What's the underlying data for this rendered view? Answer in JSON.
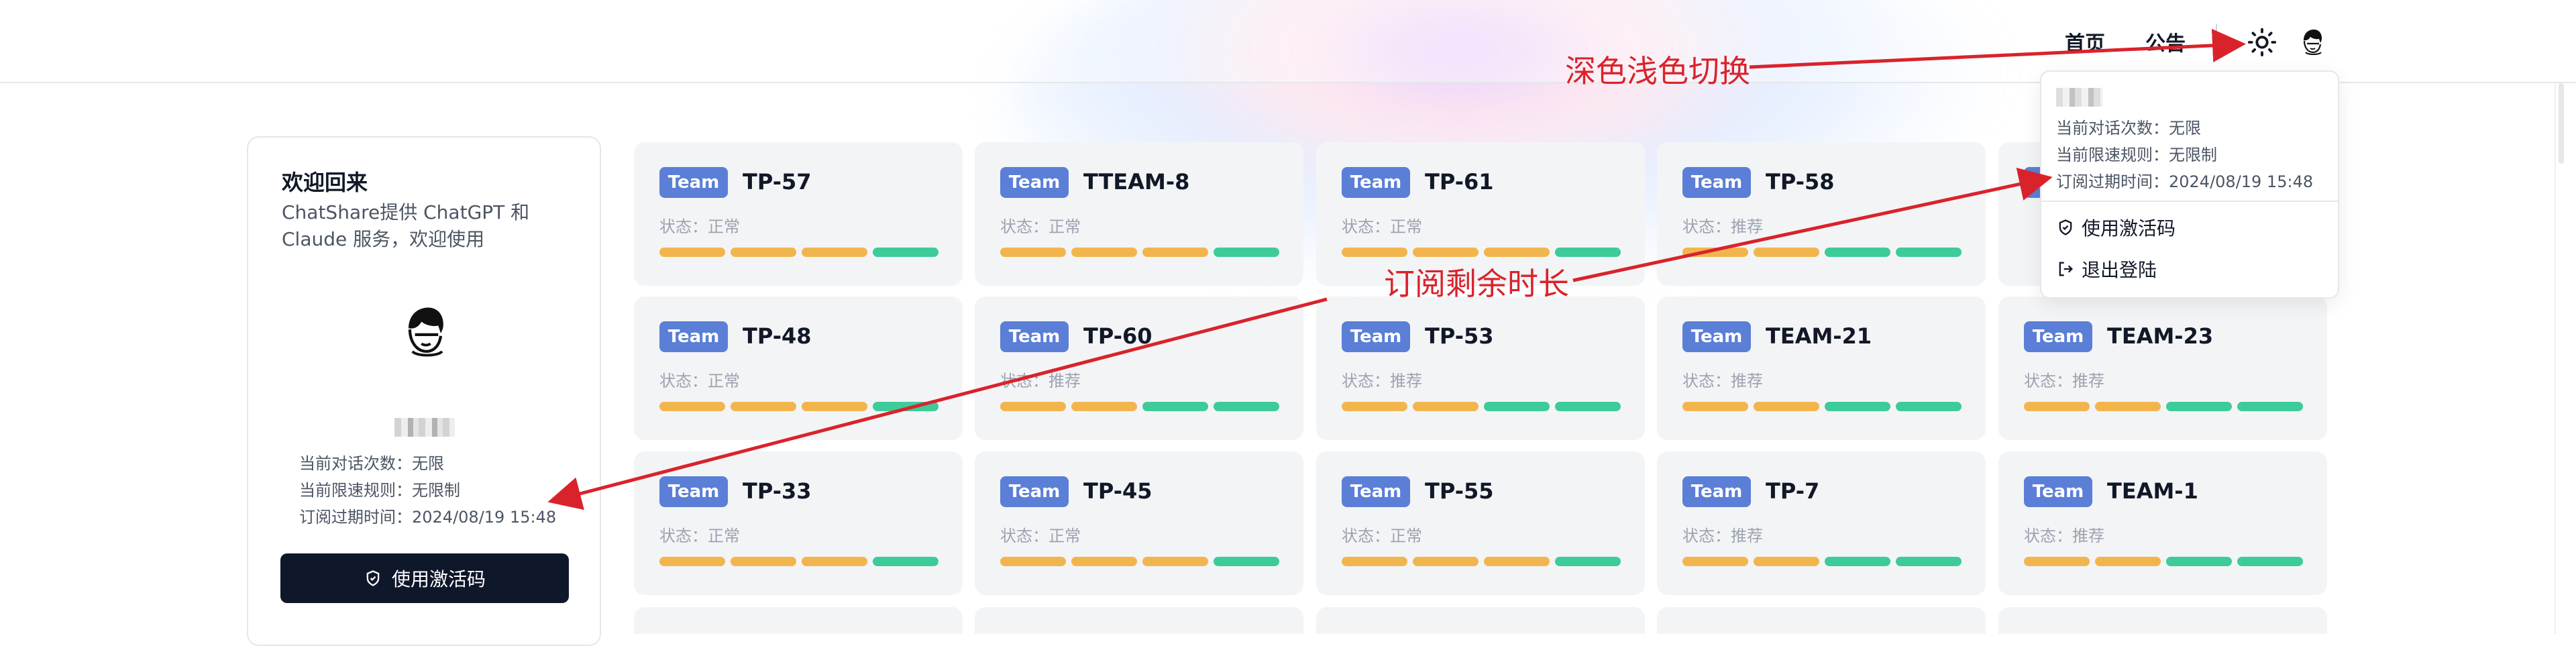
{
  "nav": {
    "home": "首页",
    "announcement": "公告"
  },
  "welcome": {
    "title": "欢迎回来",
    "subtitle": "ChatShare提供 ChatGPT 和 Claude 服务，欢迎使用",
    "info": [
      "当前对话次数：无限",
      "当前限速规则：无限制",
      "订阅过期时间：2024/08/19 15:48"
    ],
    "button": "使用激活码"
  },
  "colors": {
    "badge": "#5b7fd6",
    "bar_orange": "#f2b54d",
    "bar_green": "#3ecb9a",
    "annotation": "#d9232b"
  },
  "cards": [
    {
      "badge": "Team",
      "name": "TP-57",
      "status": "状态：正常",
      "bars": [
        "o",
        "o",
        "o",
        "g"
      ]
    },
    {
      "badge": "Team",
      "name": "TTEAM-8",
      "status": "状态：正常",
      "bars": [
        "o",
        "o",
        "o",
        "g"
      ]
    },
    {
      "badge": "Team",
      "name": "TP-61",
      "status": "状态：正常",
      "bars": [
        "o",
        "o",
        "o",
        "g"
      ]
    },
    {
      "badge": "Team",
      "name": "TP-58",
      "status": "状态：推荐",
      "bars": [
        "o",
        "o",
        "g",
        "g"
      ]
    },
    {
      "badge": "Team",
      "name": "",
      "status": "",
      "bars": []
    },
    {
      "badge": "Team",
      "name": "TP-48",
      "status": "状态：正常",
      "bars": [
        "o",
        "o",
        "o",
        "g"
      ]
    },
    {
      "badge": "Team",
      "name": "TP-60",
      "status": "状态：推荐",
      "bars": [
        "o",
        "o",
        "g",
        "g"
      ]
    },
    {
      "badge": "Team",
      "name": "TP-53",
      "status": "状态：推荐",
      "bars": [
        "o",
        "o",
        "g",
        "g"
      ]
    },
    {
      "badge": "Team",
      "name": "TEAM-21",
      "status": "状态：推荐",
      "bars": [
        "o",
        "o",
        "g",
        "g"
      ]
    },
    {
      "badge": "Team",
      "name": "TEAM-23",
      "status": "状态：推荐",
      "bars": [
        "o",
        "o",
        "g",
        "g"
      ]
    },
    {
      "badge": "Team",
      "name": "TP-33",
      "status": "状态：正常",
      "bars": [
        "o",
        "o",
        "o",
        "g"
      ]
    },
    {
      "badge": "Team",
      "name": "TP-45",
      "status": "状态：正常",
      "bars": [
        "o",
        "o",
        "o",
        "g"
      ]
    },
    {
      "badge": "Team",
      "name": "TP-55",
      "status": "状态：正常",
      "bars": [
        "o",
        "o",
        "o",
        "g"
      ]
    },
    {
      "badge": "Team",
      "name": "TP-7",
      "status": "状态：推荐",
      "bars": [
        "o",
        "o",
        "g",
        "g"
      ]
    },
    {
      "badge": "Team",
      "name": "TEAM-1",
      "status": "状态：推荐",
      "bars": [
        "o",
        "o",
        "g",
        "g"
      ]
    }
  ],
  "dropdown": {
    "info": [
      "当前对话次数：无限",
      "当前限速规则：无限制",
      "订阅过期时间：2024/08/19 15:48"
    ],
    "activate": "使用激活码",
    "logout": "退出登陆"
  },
  "annotations": {
    "theme_toggle": "深色浅色切换",
    "remaining": "订阅剩余时长"
  }
}
